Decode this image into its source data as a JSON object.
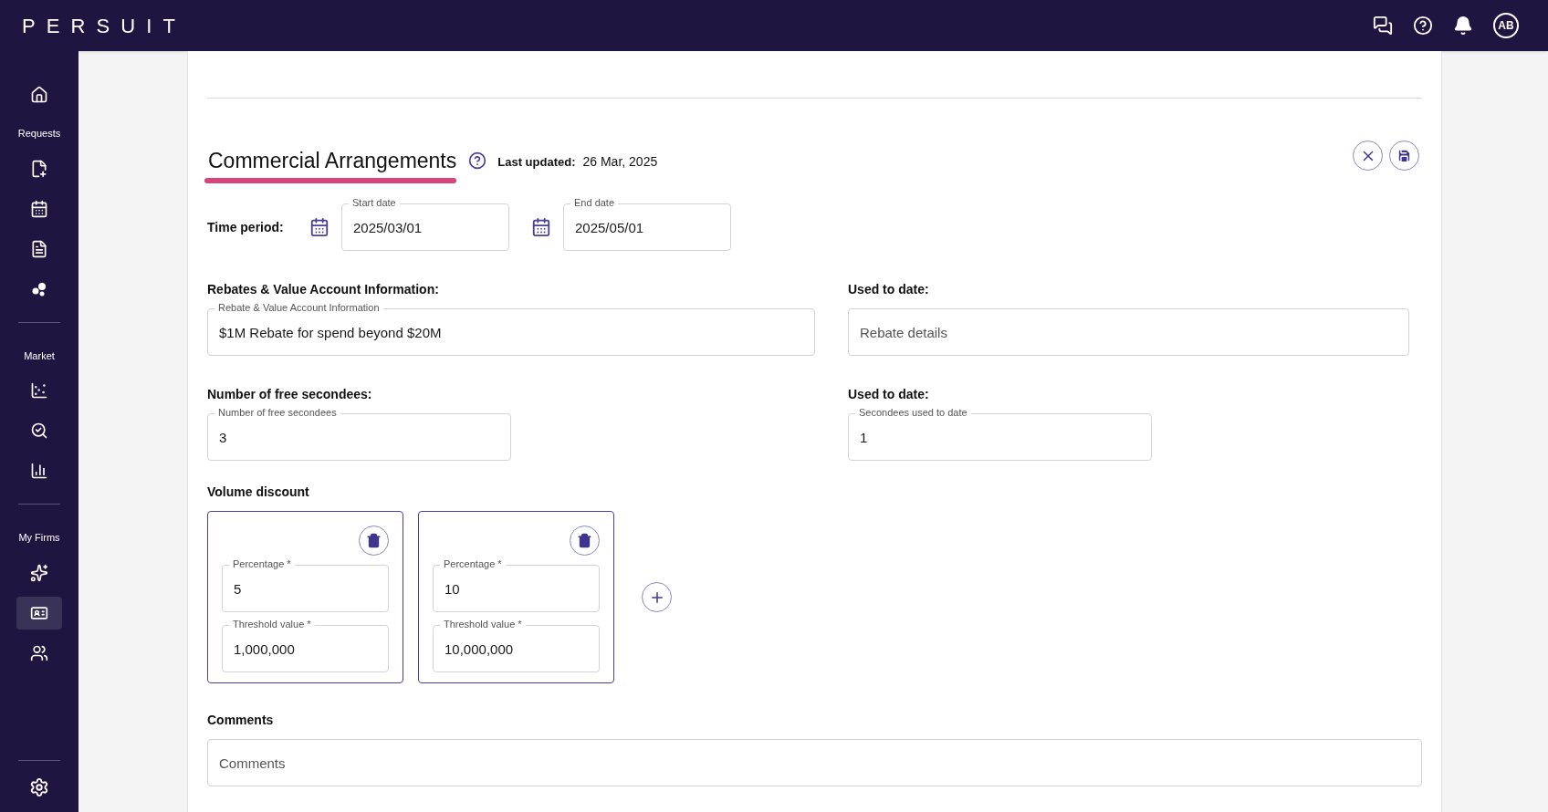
{
  "brand": "PERSUIT",
  "top_bar": {
    "avatar": "AB"
  },
  "sidebar": {
    "sections": [
      {
        "items": [
          {
            "selected": false
          }
        ]
      },
      {
        "label": "Requests",
        "items": [
          {
            "selected": false
          },
          {
            "selected": false
          },
          {
            "selected": false
          },
          {
            "selected": false
          }
        ]
      },
      {
        "label": "Market",
        "items": [
          {
            "selected": false
          },
          {
            "selected": false
          },
          {
            "selected": false
          }
        ]
      },
      {
        "label": "My Firms",
        "items": [
          {
            "selected": false
          },
          {
            "selected": true
          },
          {
            "selected": false
          }
        ]
      }
    ]
  },
  "form": {
    "title": "Commercial Arrangements",
    "last_updated_label": "Last updated:",
    "last_updated": "26 Mar, 2025",
    "time_period": {
      "label": "Time period:",
      "start": {
        "label": "Start date",
        "value": "2025/03/01"
      },
      "end": {
        "label": "End date",
        "value": "2025/05/01"
      }
    },
    "rows": [
      {
        "left": {
          "heading": "Rebates & Value Account Information:",
          "label": "Rebate & Value Account Information",
          "value": "$1M Rebate for spend beyond $20M"
        },
        "right": {
          "heading": "Used to date:",
          "placeholder": "Rebate details"
        }
      },
      {
        "left": {
          "heading": "Number of free secondees:",
          "label": "Number of free secondees",
          "value": "3"
        },
        "right": {
          "heading": "Used to date:",
          "label": "Secondees used to date",
          "value": "1"
        }
      }
    ],
    "volume_discount": {
      "heading": "Volume discount",
      "tiers": [
        {
          "percentage_label": "Percentage *",
          "percentage": "5",
          "threshold_label": "Threshold value *",
          "threshold": "1,000,000"
        },
        {
          "percentage_label": "Percentage *",
          "percentage": "10",
          "threshold_label": "Threshold value *",
          "threshold": "10,000,000"
        }
      ]
    },
    "comments": {
      "heading": "Comments",
      "placeholder": "Comments"
    }
  }
}
